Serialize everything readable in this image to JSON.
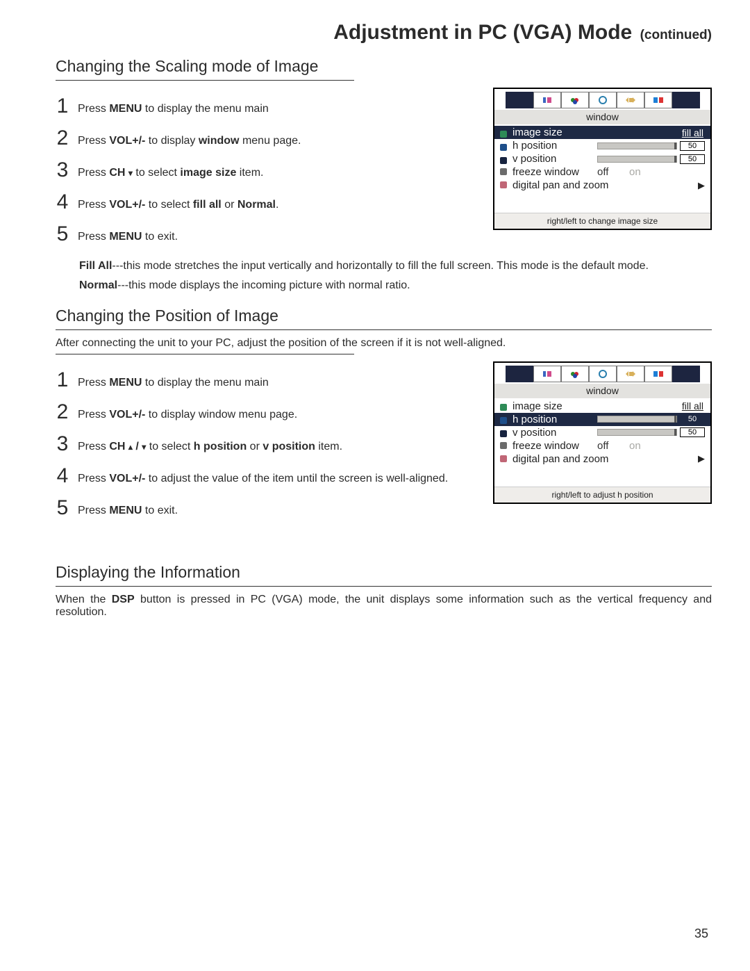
{
  "page_title_main": "Adjustment in PC (VGA) Mode",
  "page_title_cont": "(continued)",
  "page_number": "35",
  "section1": {
    "heading": "Changing the Scaling mode of Image",
    "steps_html": [
      "Press <span class='b'>MENU</span> to display the menu main",
      "Press <span class='b'>VOL+/-</span> to display <span class='b'>window</span> menu page.",
      "Press <span class='b'>CH <span style='font-size:12px'>▾</span></span> to select <span class='b'>image size</span> item.",
      "Press <span class='b'>VOL+/-</span> to select <span class='b'>fill all</span> or <span class='b'>Normal</span>.",
      "Press <span class='b'>MENU</span> to exit."
    ],
    "notes_html": [
      "<span class='b'>Fill All</span>---this mode stretches the input vertically and horizontally to fill the full screen. This mode is the default mode.",
      "<span class='b'>Normal</span>---this mode displays the incoming picture with normal ratio."
    ]
  },
  "section2": {
    "heading": "Changing the Position of Image",
    "intro": "After connecting the unit to your PC, adjust the position of the screen if it is not well-aligned.",
    "steps_html": [
      "Press <span class='b'>MENU</span> to display the menu main",
      "Press <span class='b'>VOL+/-</span> to display window menu page.",
      "Press <span class='b'>CH <span style='font-size:12px'>▴</span> / <span style='font-size:12px'>▾</span></span> to select <span class='b'>h position</span> or <span class='b'>v position</span> item.",
      "Press <span class='b'>VOL+/-</span> to adjust the value of the item until the screen is well-aligned.",
      "Press <span class='b'>MENU</span> to exit."
    ]
  },
  "section3": {
    "heading": "Displaying the Information",
    "body_html": "When the <span class='b'>DSP</span> button is pressed in PC (VGA) mode, the unit displays some information such as the vertical frequency and resolution."
  },
  "osd": {
    "section_label": "window",
    "image_size_label": "image size",
    "image_size_value": "fill all",
    "h_label": "h position",
    "h_value": "50",
    "v_label": "v position",
    "v_value": "50",
    "freeze_label": "freeze window",
    "off": "off",
    "on": "on",
    "pan_label": "digital pan and zoom",
    "hint1": "right/left to change image size",
    "hint2": "right/left to adjust h position"
  }
}
